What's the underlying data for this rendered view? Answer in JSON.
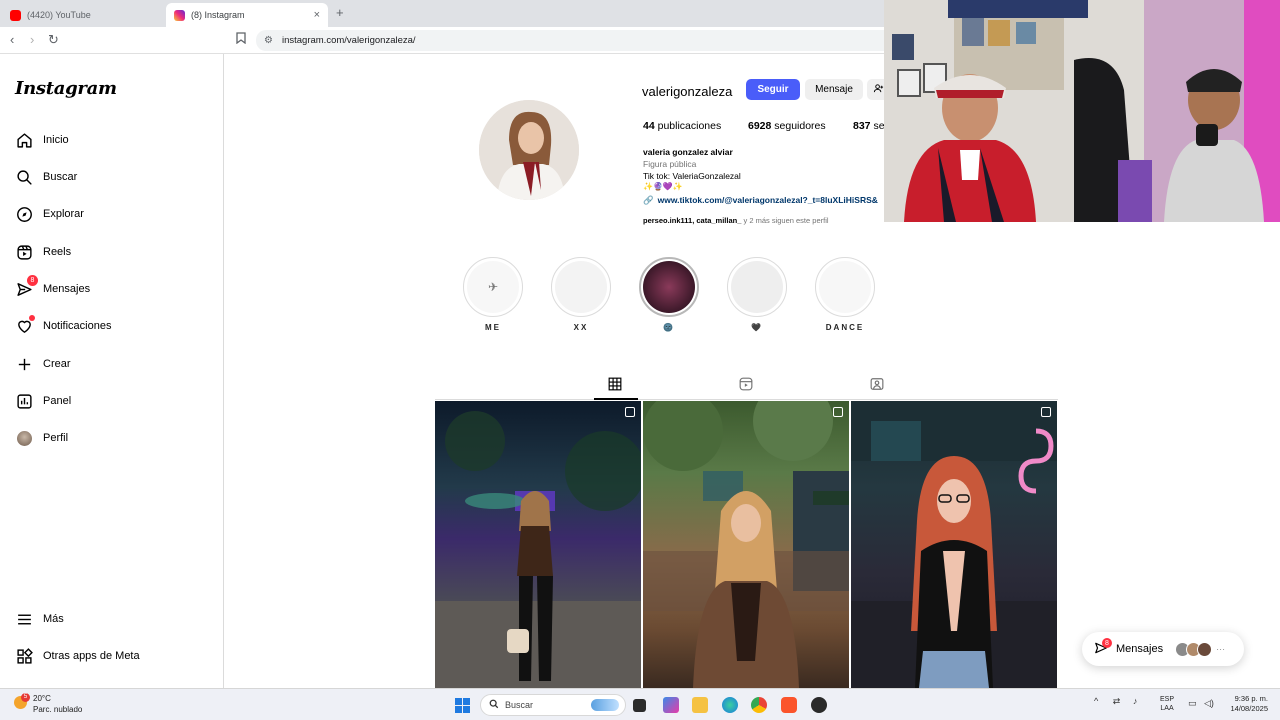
{
  "browser": {
    "tabs": [
      {
        "label": "(4420) YouTube"
      },
      {
        "label": "(8) Instagram"
      }
    ],
    "new_tab": "+",
    "close": "×",
    "url": "instagram.com/valerigonzaleza/"
  },
  "sidebar": {
    "logo": "Instagram",
    "items": [
      {
        "label": "Inicio",
        "icon": "home-icon"
      },
      {
        "label": "Buscar",
        "icon": "search-icon"
      },
      {
        "label": "Explorar",
        "icon": "compass-icon"
      },
      {
        "label": "Reels",
        "icon": "reels-icon"
      },
      {
        "label": "Mensajes",
        "icon": "messenger-icon",
        "badge": "8"
      },
      {
        "label": "Notificaciones",
        "icon": "heart-icon"
      },
      {
        "label": "Crear",
        "icon": "plus-icon"
      },
      {
        "label": "Panel",
        "icon": "chart-icon"
      },
      {
        "label": "Perfil",
        "icon": "avatar-icon"
      }
    ],
    "more": "Más",
    "meta_apps": "Otras apps de Meta"
  },
  "profile": {
    "username": "valerigonzaleza",
    "follow_label": "Seguir",
    "message_label": "Mensaje",
    "posts_count": "44",
    "posts_label": "publicaciones",
    "followers_count": "6928",
    "followers_label": "seguidores",
    "following_count": "837",
    "following_label": "se",
    "full_name": "valeria gonzalez alviar",
    "category": "Figura pública",
    "bio_line": "Tik tok: ValeriaGonzalezal",
    "bio_emojis": "✨🔮💜✨",
    "link": "www.tiktok.com/@valeriagonzalezal?_t=8luXLiHiSRS&",
    "followed_by_names": "perseo.ink111, cata_millan_",
    "followed_by_rest": " y 2 más siguen este perfil"
  },
  "highlights": [
    {
      "label": "ME",
      "glyph": "✈"
    },
    {
      "label": "XX",
      "glyph": ""
    },
    {
      "label": "🌚",
      "glyph": ""
    },
    {
      "label": "🖤",
      "glyph": ""
    },
    {
      "label": "DANCE",
      "glyph": ""
    }
  ],
  "messages_pill": {
    "label": "Mensajes",
    "badge": "8",
    "more": "···"
  },
  "taskbar": {
    "weather_temp": "20°C",
    "weather_desc": "Parc. nublado",
    "weather_badge": "5",
    "search_placeholder": "Buscar",
    "lang_top": "ESP",
    "lang_bottom": "LAA",
    "time": "9:36 p. m.",
    "date": "14/08/2025"
  },
  "colors": {
    "follow_button": "#4a5df9",
    "notification_red": "#ff3040",
    "link_blue": "#00376b"
  }
}
